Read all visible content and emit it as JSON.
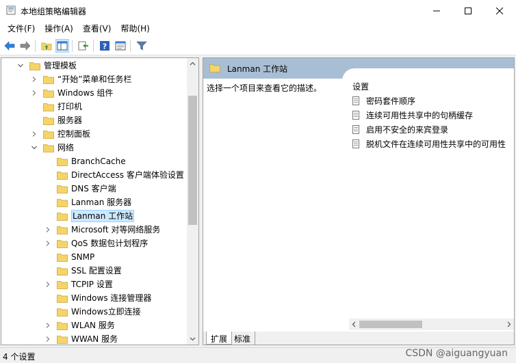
{
  "window": {
    "title": "本地组策略编辑器"
  },
  "menu": [
    "文件(F)",
    "操作(A)",
    "查看(V)",
    "帮助(H)"
  ],
  "toolbar": {
    "icons": [
      "back-icon",
      "forward-icon",
      "up-folder-icon",
      "show-hide-tree-icon",
      "export-list-icon",
      "help-icon",
      "properties-icon",
      "filter-icon"
    ]
  },
  "tree": [
    {
      "label": "管理模板",
      "level": 0,
      "expanded": true
    },
    {
      "label": "“开始”菜单和任务栏",
      "level": 1,
      "chevron": "right"
    },
    {
      "label": "Windows 组件",
      "level": 1,
      "chevron": "right"
    },
    {
      "label": "打印机",
      "level": 1,
      "chevron": ""
    },
    {
      "label": "服务器",
      "level": 1,
      "chevron": ""
    },
    {
      "label": "控制面板",
      "level": 1,
      "chevron": "right"
    },
    {
      "label": "网络",
      "level": 1,
      "chevron": "down"
    },
    {
      "label": "BranchCache",
      "level": 2,
      "chevron": ""
    },
    {
      "label": "DirectAccess 客户端体验设置",
      "level": 2,
      "chevron": ""
    },
    {
      "label": "DNS 客户端",
      "level": 2,
      "chevron": ""
    },
    {
      "label": "Lanman 服务器",
      "level": 2,
      "chevron": ""
    },
    {
      "label": "Lanman 工作站",
      "level": 2,
      "chevron": "",
      "selected": true
    },
    {
      "label": "Microsoft 对等网络服务",
      "level": 2,
      "chevron": "right"
    },
    {
      "label": "QoS 数据包计划程序",
      "level": 2,
      "chevron": "right"
    },
    {
      "label": "SNMP",
      "level": 2,
      "chevron": ""
    },
    {
      "label": "SSL 配置设置",
      "level": 2,
      "chevron": ""
    },
    {
      "label": "TCPIP 设置",
      "level": 2,
      "chevron": "right"
    },
    {
      "label": "Windows 连接管理器",
      "level": 2,
      "chevron": ""
    },
    {
      "label": "Windows立即连接",
      "level": 2,
      "chevron": ""
    },
    {
      "label": "WLAN 服务",
      "level": 2,
      "chevron": "right"
    },
    {
      "label": "WWAN 服务",
      "level": 2,
      "chevron": "right"
    }
  ],
  "detail": {
    "header_title": "Lanman 工作站",
    "description": "选择一个项目来查看它的描述。",
    "column_header": "设置",
    "settings": [
      "密码套件顺序",
      "连续可用性共享中的句柄缓存",
      "启用不安全的来宾登录",
      "脱机文件在连续可用性共享中的可用性"
    ],
    "tabs": [
      "扩展",
      "标准"
    ]
  },
  "status": {
    "text": "4 个设置",
    "watermark": "CSDN @aiguangyuan"
  },
  "colors": {
    "header_band": "#a8bed4",
    "folder_yellow": "#f5d46a",
    "selection": "#cce8ff"
  }
}
